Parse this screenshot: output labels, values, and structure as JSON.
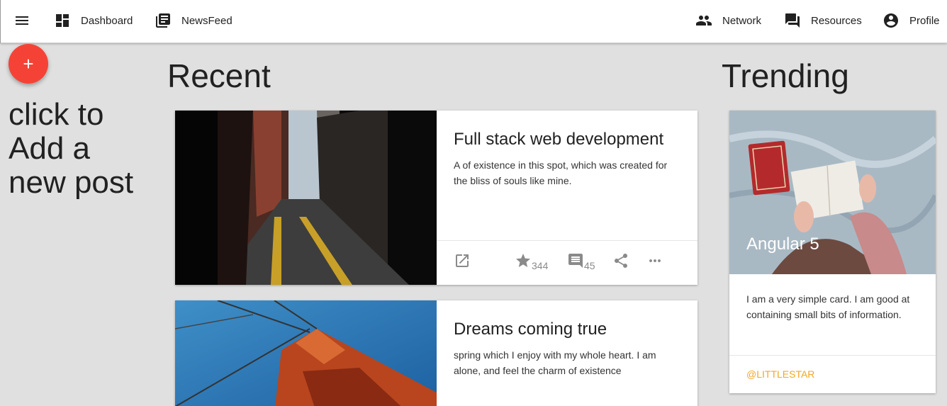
{
  "nav": {
    "dashboard": "Dashboard",
    "newsfeed": "NewsFeed",
    "network": "Network",
    "resources": "Resources",
    "profile": "Profile"
  },
  "fab": {
    "label": "+"
  },
  "add_post_text": "click to Add a new post",
  "sections": {
    "recent": "Recent",
    "trending": "Trending"
  },
  "recent_posts": [
    {
      "title": "Full stack web development",
      "description": "A of existence in this spot, which was created for the bliss of souls like mine.",
      "stars": "344",
      "comments": "45"
    },
    {
      "title": "Dreams coming true",
      "description": "spring which I enjoy with my whole heart. I am alone, and feel the charm of existence"
    }
  ],
  "trending_card": {
    "title": "Angular 5",
    "description": "I am a very simple card. I am good at containing small bits of information.",
    "link": "@LITTLESTAR"
  },
  "colors": {
    "fab": "#f44336",
    "link": "#f5a623",
    "background": "#e0e0e0"
  }
}
